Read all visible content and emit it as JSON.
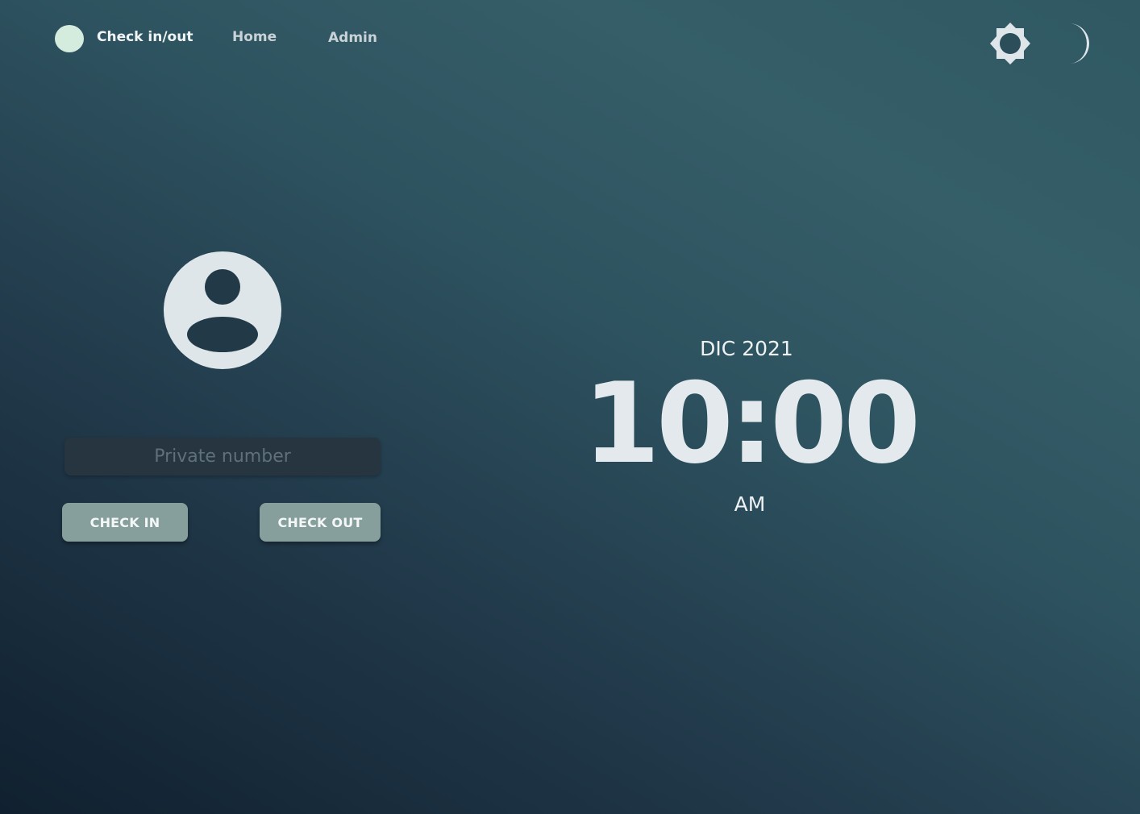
{
  "nav": {
    "brand": "Check in/out",
    "links": [
      {
        "label": "Home"
      },
      {
        "label": "Admin"
      }
    ]
  },
  "theme_toggle": {
    "light_icon": "sun-icon",
    "dark_icon": "moon-icon"
  },
  "form": {
    "avatar_icon": "user-avatar-icon",
    "private_number": {
      "placeholder": "Private number",
      "value": ""
    },
    "check_in_label": "CHECK IN",
    "check_out_label": "CHECK OUT"
  },
  "clock": {
    "date": "DIC 2021",
    "time": "10:00",
    "period": "AM"
  },
  "colors": {
    "brand_dot": "#d3ecdd",
    "button_bg": "#869f9c",
    "icon": "#dfe6ea",
    "background_dark": "#10202f",
    "background_light": "#355e68"
  }
}
